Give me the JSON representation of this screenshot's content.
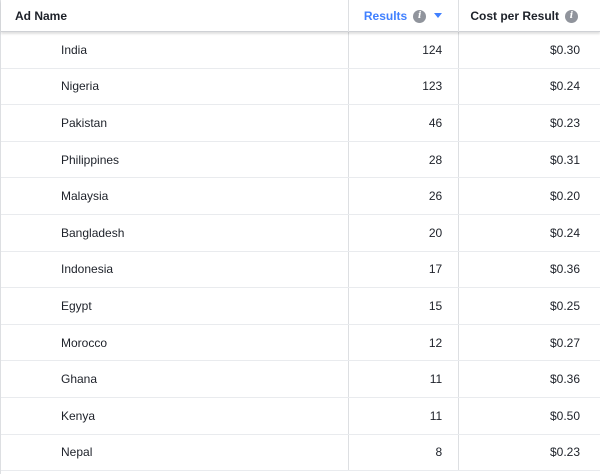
{
  "columns": {
    "name": "Ad Name",
    "results": "Results",
    "cost": "Cost per Result"
  },
  "icons": {
    "info": "info-icon",
    "sort": "sort-descending-icon"
  },
  "colors": {
    "accent": "#4080ff",
    "icon_gray": "#90949c"
  },
  "rows": [
    {
      "name": "India",
      "results": "124",
      "cost": "$0.30"
    },
    {
      "name": "Nigeria",
      "results": "123",
      "cost": "$0.24"
    },
    {
      "name": "Pakistan",
      "results": "46",
      "cost": "$0.23"
    },
    {
      "name": "Philippines",
      "results": "28",
      "cost": "$0.31"
    },
    {
      "name": "Malaysia",
      "results": "26",
      "cost": "$0.20"
    },
    {
      "name": "Bangladesh",
      "results": "20",
      "cost": "$0.24"
    },
    {
      "name": "Indonesia",
      "results": "17",
      "cost": "$0.36"
    },
    {
      "name": "Egypt",
      "results": "15",
      "cost": "$0.25"
    },
    {
      "name": "Morocco",
      "results": "12",
      "cost": "$0.27"
    },
    {
      "name": "Ghana",
      "results": "11",
      "cost": "$0.36"
    },
    {
      "name": "Kenya",
      "results": "11",
      "cost": "$0.50"
    },
    {
      "name": "Nepal",
      "results": "8",
      "cost": "$0.23"
    }
  ]
}
